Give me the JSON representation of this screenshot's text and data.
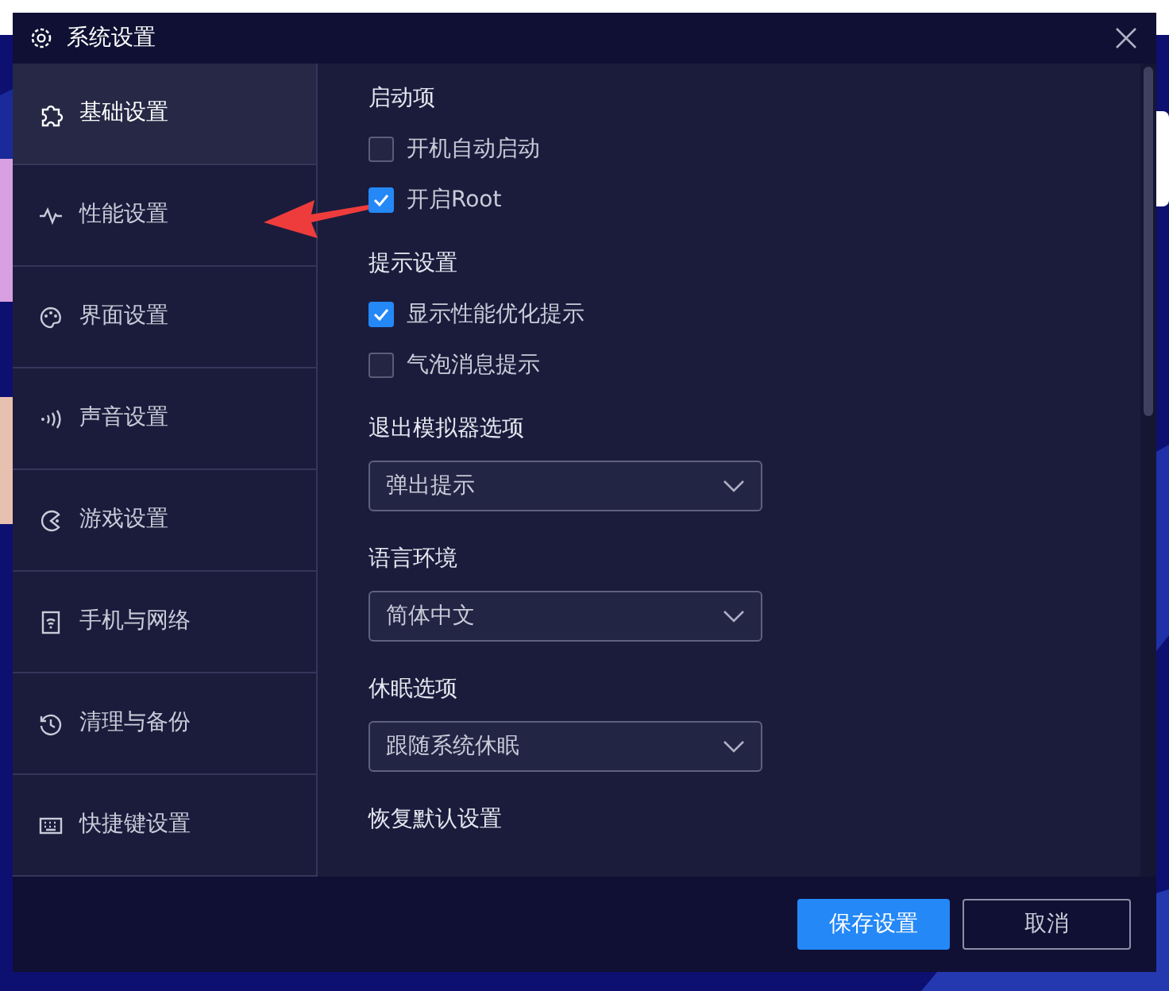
{
  "window": {
    "title": "系统设置"
  },
  "sidebar": {
    "items": [
      {
        "label": "基础设置",
        "selected": true
      },
      {
        "label": "性能设置",
        "selected": false
      },
      {
        "label": "界面设置",
        "selected": false
      },
      {
        "label": "声音设置",
        "selected": false
      },
      {
        "label": "游戏设置",
        "selected": false
      },
      {
        "label": "手机与网络",
        "selected": false
      },
      {
        "label": "清理与备份",
        "selected": false
      },
      {
        "label": "快捷键设置",
        "selected": false
      }
    ]
  },
  "sections": [
    {
      "title": "启动项",
      "kind": "checks",
      "options": [
        {
          "label": "开机自动启动",
          "checked": false
        },
        {
          "label": "开启Root",
          "checked": true
        }
      ]
    },
    {
      "title": "提示设置",
      "kind": "checks",
      "options": [
        {
          "label": "显示性能优化提示",
          "checked": true
        },
        {
          "label": "气泡消息提示",
          "checked": false
        }
      ]
    },
    {
      "title": "退出模拟器选项",
      "kind": "select",
      "value": "弹出提示"
    },
    {
      "title": "语言环境",
      "kind": "select",
      "value": "简体中文"
    },
    {
      "title": "休眠选项",
      "kind": "select",
      "value": "跟随系统休眠"
    },
    {
      "title": "恢复默认设置",
      "kind": "heading"
    }
  ],
  "buttons": [
    {
      "label": "保存设置",
      "kind": "primary"
    },
    {
      "label": "取消",
      "kind": "outline"
    }
  ]
}
